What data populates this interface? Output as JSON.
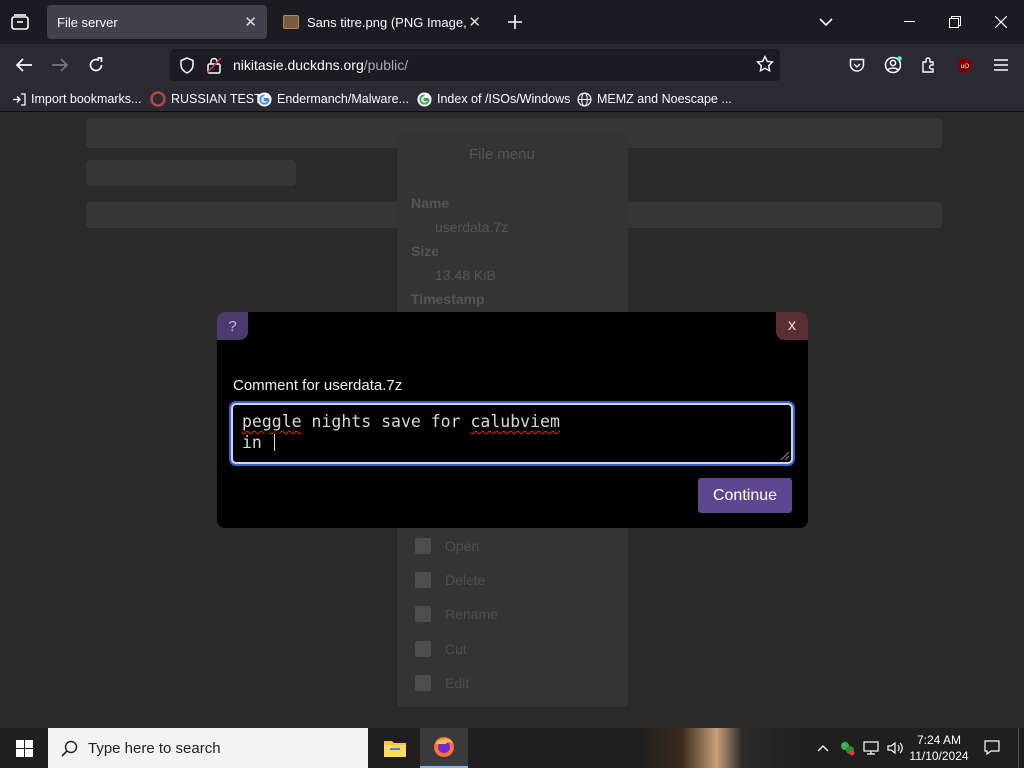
{
  "browser": {
    "tabs": [
      {
        "title": "File server",
        "active": true
      },
      {
        "title": "Sans titre.png (PNG Image, 335",
        "active": false
      }
    ],
    "url": {
      "host": "nikitasie.duckdns.org",
      "path": "/public/"
    },
    "bookmarks": [
      {
        "label": "Import bookmarks...",
        "icon": "import-icon"
      },
      {
        "label": "RUSSIAN TEST",
        "icon": "site-icon"
      },
      {
        "label": "Endermanch/Malware...",
        "icon": "google-icon"
      },
      {
        "label": "Index of /ISOs/Windows",
        "icon": "google-icon"
      },
      {
        "label": "MEMZ and Noescape ...",
        "icon": "globe-icon"
      }
    ]
  },
  "modal": {
    "help_label": "?",
    "close_label": "x",
    "title": "Comment for userdata.7z",
    "comment_line1_a": "peggle",
    "comment_line1_b": " nights save for ",
    "comment_line1_c": "calubviem",
    "comment_line2": "in ",
    "continue_label": "Continue"
  },
  "background": {
    "file_menu_title": "File menu",
    "name_label": "Name",
    "name_value": "userdata.7z",
    "size_label": "Size",
    "size_value": "13.48 KiB",
    "timestamp_label": "Timestamp",
    "actions": [
      "Open",
      "Delete",
      "Rename",
      "Cut",
      "Edit"
    ]
  },
  "taskbar": {
    "search_placeholder": "Type here to search",
    "time": "7:24 AM",
    "date": "11/10/2024"
  },
  "colors": {
    "accent": "#5f4690",
    "focus_ring": "#3a61c8"
  }
}
